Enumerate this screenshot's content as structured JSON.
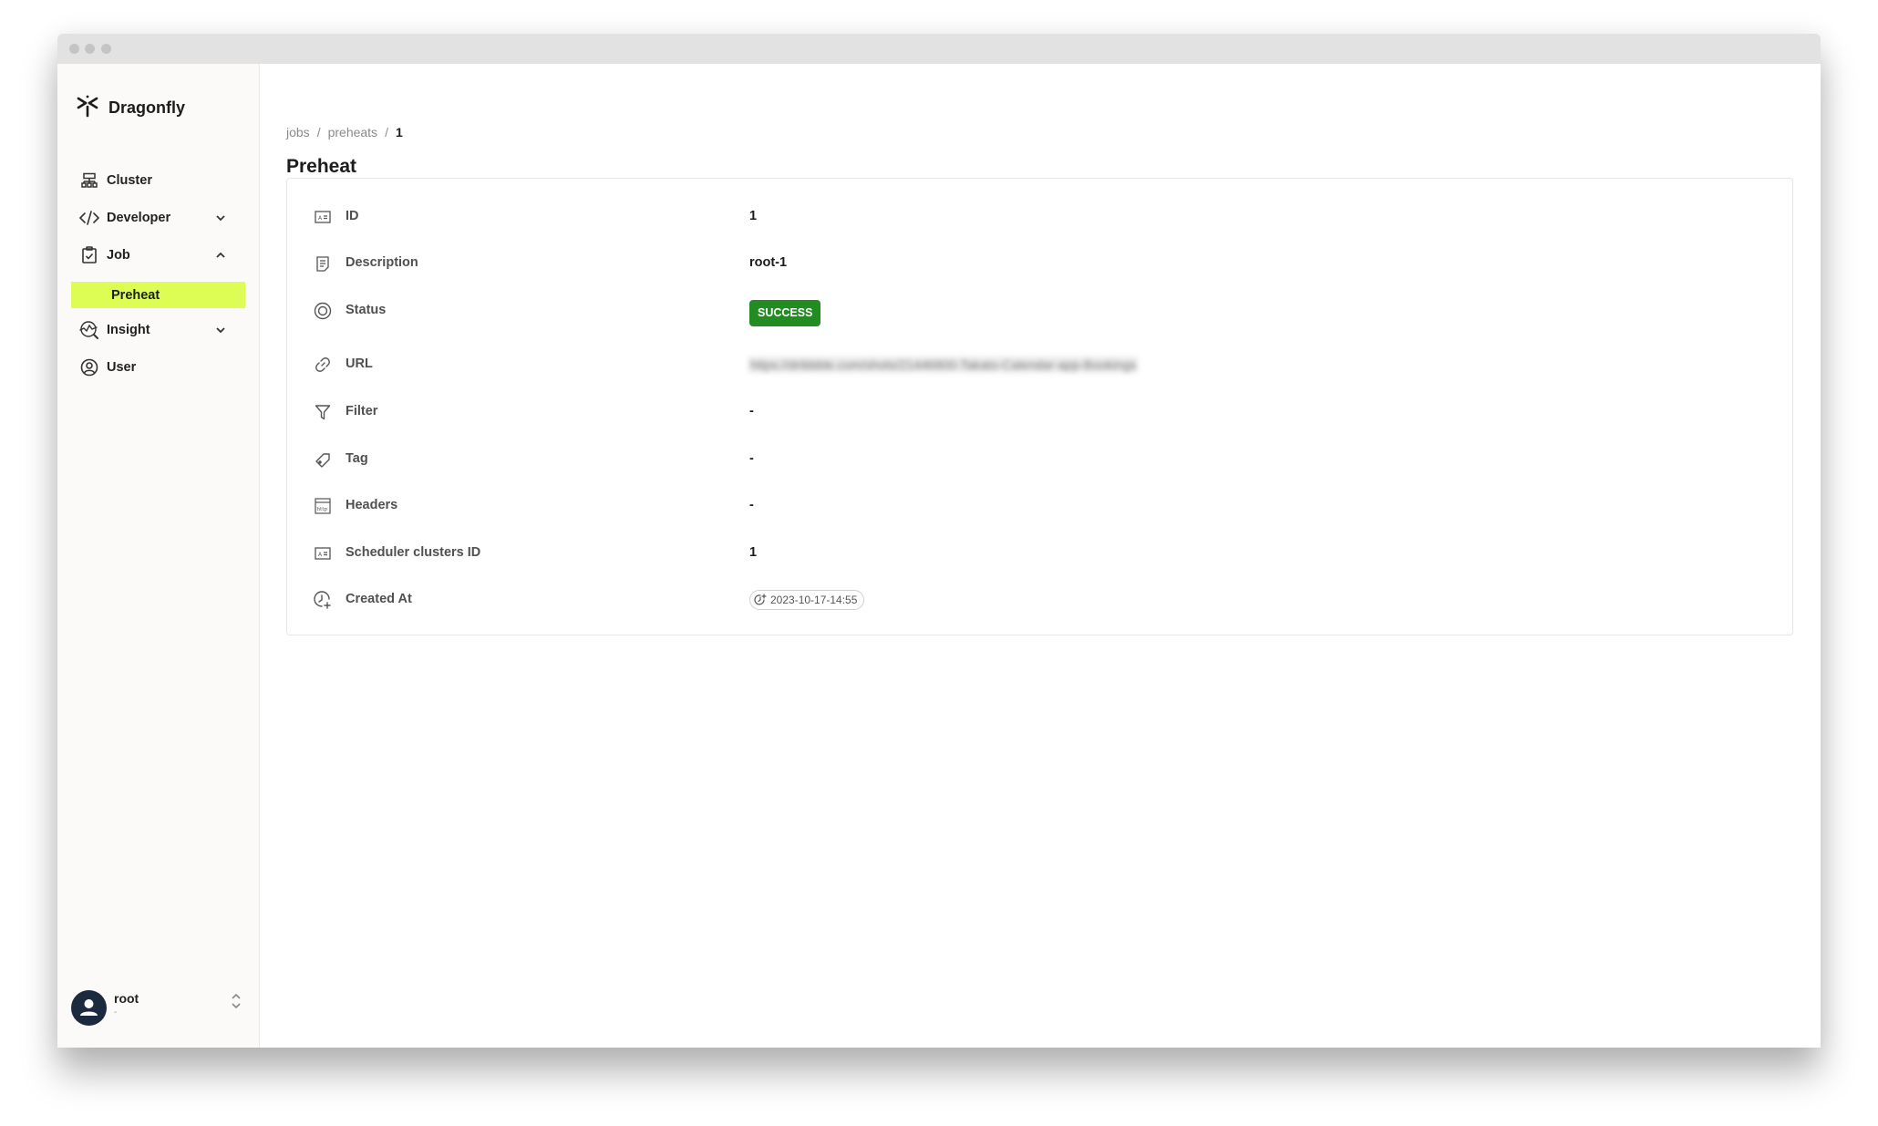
{
  "window": {
    "controls": [
      "close",
      "minimize",
      "maximize"
    ]
  },
  "sidebar": {
    "brand": {
      "name": "Dragonfly",
      "icon": "dragonfly-logo-icon"
    },
    "items": [
      {
        "label": "Cluster",
        "icon": "cluster-icon",
        "expandable": false
      },
      {
        "label": "Developer",
        "icon": "code-icon",
        "expandable": true,
        "expanded": false
      },
      {
        "label": "Job",
        "icon": "clipboard-check-icon",
        "expandable": true,
        "expanded": true,
        "children": [
          {
            "label": "Preheat",
            "active": true
          }
        ]
      },
      {
        "label": "Insight",
        "icon": "insight-icon",
        "expandable": true,
        "expanded": false
      },
      {
        "label": "User",
        "icon": "user-circle-icon",
        "expandable": false
      }
    ],
    "user": {
      "name": "root",
      "subtitle": "-"
    }
  },
  "breadcrumb": {
    "items": [
      "jobs",
      "preheats"
    ],
    "current": "1",
    "separator": "/"
  },
  "page_title": "Preheat",
  "details": {
    "rows": [
      {
        "label": "ID",
        "icon": "id-card-icon",
        "value": "1"
      },
      {
        "label": "Description",
        "icon": "document-icon",
        "value": "root-1"
      },
      {
        "label": "Status",
        "icon": "status-circle-icon",
        "value": "SUCCESS",
        "color": "#228b22"
      },
      {
        "label": "URL",
        "icon": "link-icon",
        "value": "https://dribbble.com/shots/21446800-Takato-Calendar-app-Bookings",
        "blurred": true
      },
      {
        "label": "Filter",
        "icon": "filter-icon",
        "value": "-"
      },
      {
        "label": "Tag",
        "icon": "tag-icon",
        "value": "-"
      },
      {
        "label": "Headers",
        "icon": "http-icon",
        "value": "-"
      },
      {
        "label": "Scheduler clusters ID",
        "icon": "id-card-icon",
        "value": "1"
      },
      {
        "label": "Created At",
        "icon": "clock-plus-icon",
        "value": "2023-10-17-14:55"
      }
    ]
  },
  "colors": {
    "accent": "#ddfd55",
    "success": "#228b22",
    "avatar": "#1b2a3e"
  }
}
